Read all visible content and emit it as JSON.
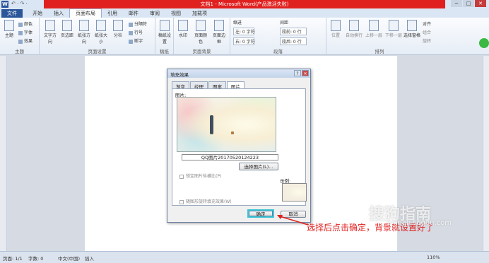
{
  "window": {
    "title": "文档1 - Microsoft Word(产品激活失败)",
    "qat": "↶ · ↷ ·",
    "buttons": [
      "─",
      "□",
      "✕"
    ]
  },
  "tabs": [
    "文件",
    "开始",
    "插入",
    "页面布局",
    "引用",
    "邮件",
    "审阅",
    "视图",
    "加载项"
  ],
  "active_tab": "页面布局",
  "ribbon": {
    "theme": {
      "big": "主题",
      "color": "颜色",
      "font": "字体",
      "effect": "效果",
      "label": "主题"
    },
    "page_setup": {
      "text_dir": "文字方向",
      "margins": "页边距",
      "orientation": "纸张方向",
      "size": "纸张大小",
      "columns": "分栏",
      "breaks": "分隔符",
      "line_numbers": "行号",
      "hyphen": "断字",
      "label": "页面设置"
    },
    "draft": {
      "big": "稿纸设置",
      "label": "稿纸"
    },
    "background": {
      "watermark": "水印",
      "page_color": "页面颜色",
      "border": "页面边框",
      "label": "页面背景"
    },
    "paragraph": {
      "indent": "缩进",
      "left": "左: 0 字符",
      "right": "右: 0 字符",
      "spacing": "间距",
      "before": "段前: 0 行",
      "after": "段后: 0 行",
      "label": "段落"
    },
    "arrange": {
      "position": "位置",
      "wrap": "自动换行",
      "forward": "上移一层",
      "backward": "下移一层",
      "pane": "选择窗格",
      "align": "对齐",
      "group": "组合",
      "rotate": "旋转",
      "label": "排列"
    }
  },
  "status": {
    "page": "页面: 1/1",
    "words": "字数: 0",
    "lang": "中文(中国)",
    "mode": "插入",
    "zoom": "110%"
  },
  "dialog": {
    "title": "填充效果",
    "title_buttons": [
      "?",
      "✕"
    ],
    "tabs": [
      "渐变",
      "纹理",
      "图案",
      "图片"
    ],
    "active_tab": "图片",
    "picture_label": "图片:",
    "filename": "QQ图片20170520124223",
    "select_button": "选择图片(L)...",
    "lock_ratio": "锁定图片纵横比(P)",
    "rotate_fill": "随图形旋转填充效果(W)",
    "sample_label": "示例:",
    "ok": "确定",
    "cancel": "取消"
  },
  "annotation": "选择后点击确定，背景就设置好了",
  "watermark": {
    "text": "搜狗指南",
    "url": "zhinan.sogou.com"
  },
  "colors": {
    "accent_red": "#e0201f",
    "ok_highlight": "#3fc6d5",
    "word_blue": "#2b579a"
  }
}
